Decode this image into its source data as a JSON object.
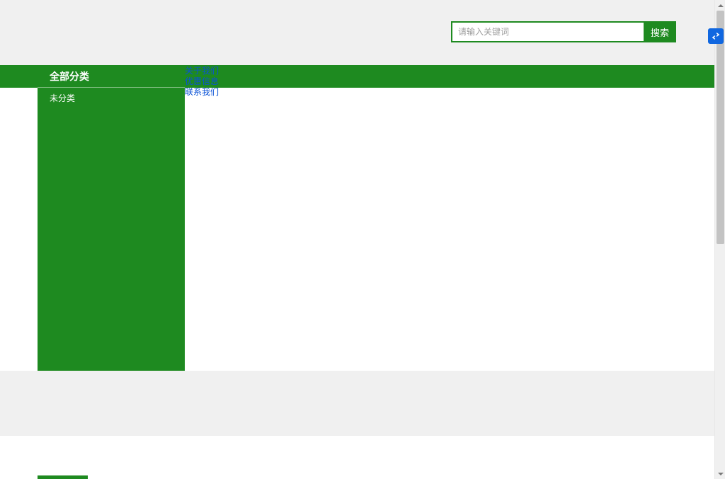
{
  "colors": {
    "brand_green": "#1e8a20",
    "link_blue": "#0a52d6",
    "ime_blue": "#1067e0",
    "page_grey": "#f0f0f0"
  },
  "search": {
    "placeholder": "请输入关键词",
    "value": "",
    "button_label": "搜索"
  },
  "sidebar": {
    "header": "全部分类",
    "items": [
      {
        "label": "未分类"
      }
    ]
  },
  "nav_links": [
    {
      "label": "关于我们"
    },
    {
      "label": "优惠信息"
    },
    {
      "label": "联系我们"
    }
  ],
  "ime_badge": {
    "name": "ime-switch-icon"
  }
}
